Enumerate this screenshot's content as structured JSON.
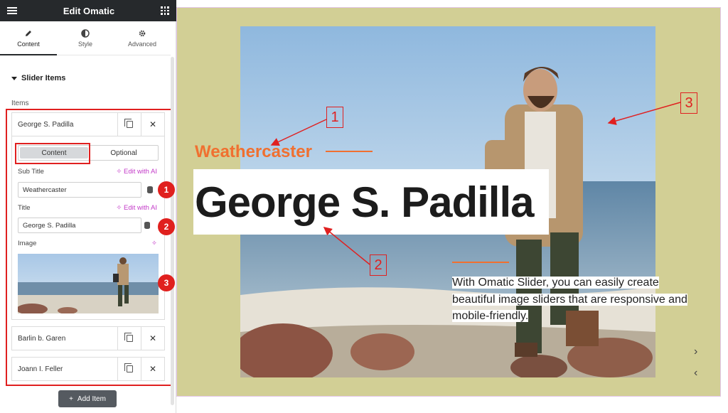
{
  "editor": {
    "title": "Edit Omatic",
    "tabs": [
      {
        "label": "Content",
        "icon": "pencil-icon"
      },
      {
        "label": "Style",
        "icon": "half-circle-icon"
      },
      {
        "label": "Advanced",
        "icon": "gear-icon"
      }
    ],
    "section_title": "Slider Items",
    "items_label": "Items",
    "items": [
      {
        "name": "George S. Padilla"
      },
      {
        "name": "Barlin b. Garen"
      },
      {
        "name": "Joann I. Feller"
      }
    ],
    "item_toggle": {
      "content": "Content",
      "optional": "Optional"
    },
    "fields": {
      "sub_title_label": "Sub Title",
      "sub_title_value": "Weathercaster",
      "title_label": "Title",
      "title_value": "George  S. Padilla",
      "image_label": "Image",
      "edit_ai": "Edit with AI"
    },
    "add_item": "Add Item"
  },
  "preview": {
    "subtitle": "Weathercaster",
    "title": "George S. Padilla",
    "description": "With Omatic Slider, you can easily create beautiful image sliders that are responsive and mobile-friendly.",
    "next_arrow": "›",
    "prev_arrow": "‹"
  },
  "annotations": {
    "badges": [
      "1",
      "2",
      "3"
    ],
    "boxes": [
      "1",
      "2",
      "3"
    ]
  },
  "colors": {
    "accent_orange": "#f07030",
    "annotation_red": "#e02020",
    "preview_bg": "#d2cf95",
    "topbar": "#26292c",
    "ai_purple": "#c33ac8"
  }
}
